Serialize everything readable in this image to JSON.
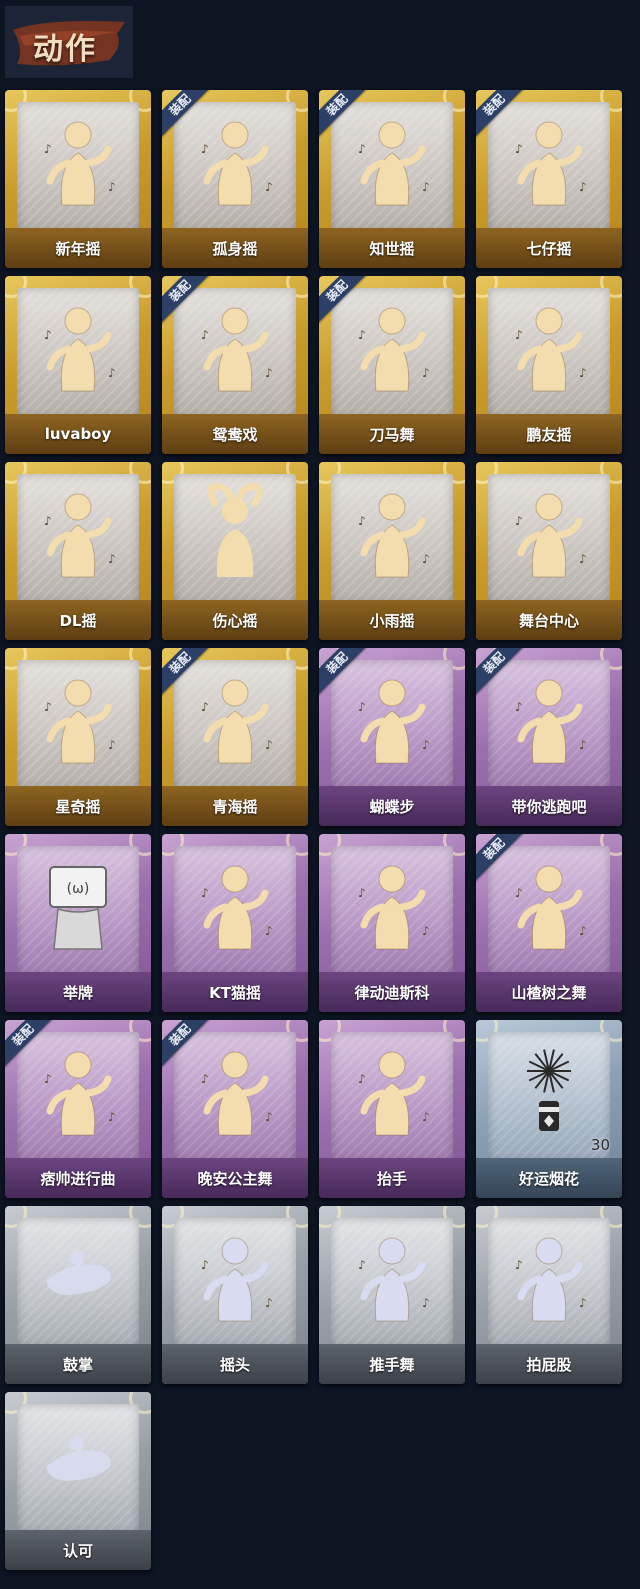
{
  "header": {
    "title": "动作"
  },
  "badge_text": "装配",
  "colors": {
    "gold": "#c99b2b",
    "purple": "#9b6fae",
    "blue": "#8da1b6",
    "grey": "#9aa0a8",
    "figure_gold": "#f3dcae",
    "figure_grey": "#d9dcf0"
  },
  "actions": [
    {
      "label": "新年摇",
      "rarity": "gold",
      "equipped": false,
      "icon": "dance-figure-icon"
    },
    {
      "label": "孤身摇",
      "rarity": "gold",
      "equipped": true,
      "icon": "dance-figure-icon"
    },
    {
      "label": "知世摇",
      "rarity": "gold",
      "equipped": true,
      "icon": "dance-figure-icon"
    },
    {
      "label": "七仔摇",
      "rarity": "gold",
      "equipped": true,
      "icon": "dance-figure-icon"
    },
    {
      "label": "luvaboy",
      "rarity": "gold",
      "equipped": false,
      "icon": "dance-figure-icon"
    },
    {
      "label": "鸳鸯戏",
      "rarity": "gold",
      "equipped": true,
      "icon": "dance-figure-icon"
    },
    {
      "label": "刀马舞",
      "rarity": "gold",
      "equipped": true,
      "icon": "dance-figure-icon"
    },
    {
      "label": "鹏友摇",
      "rarity": "gold",
      "equipped": false,
      "icon": "dance-figure-icon"
    },
    {
      "label": "DL摇",
      "rarity": "gold",
      "equipped": false,
      "icon": "dance-figure-icon"
    },
    {
      "label": "伤心摇",
      "rarity": "gold",
      "equipped": false,
      "icon": "heart-hands-figure-icon"
    },
    {
      "label": "小雨摇",
      "rarity": "gold",
      "equipped": false,
      "icon": "dance-figure-icon"
    },
    {
      "label": "舞台中心",
      "rarity": "gold",
      "equipped": false,
      "icon": "dance-figure-icon"
    },
    {
      "label": "星奇摇",
      "rarity": "gold",
      "equipped": false,
      "icon": "dance-figure-icon"
    },
    {
      "label": "青海摇",
      "rarity": "gold",
      "equipped": true,
      "icon": "dance-figure-icon"
    },
    {
      "label": "蝴蝶步",
      "rarity": "purple",
      "equipped": true,
      "icon": "dance-figure-icon"
    },
    {
      "label": "带你逃跑吧",
      "rarity": "purple",
      "equipped": true,
      "icon": "dance-figure-icon"
    },
    {
      "label": "举牌",
      "rarity": "purple",
      "equipped": false,
      "icon": "sign-holding-figure-icon"
    },
    {
      "label": "KT猫摇",
      "rarity": "purple",
      "equipped": false,
      "icon": "dance-figure-icon"
    },
    {
      "label": "律动迪斯科",
      "rarity": "purple",
      "equipped": false,
      "icon": "dance-figure-icon"
    },
    {
      "label": "山楂树之舞",
      "rarity": "purple",
      "equipped": true,
      "icon": "dance-figure-icon"
    },
    {
      "label": "痞帅进行曲",
      "rarity": "purple",
      "equipped": true,
      "icon": "dance-figure-icon"
    },
    {
      "label": "晚安公主舞",
      "rarity": "purple",
      "equipped": true,
      "icon": "dance-figure-icon"
    },
    {
      "label": "抬手",
      "rarity": "purple",
      "equipped": false,
      "icon": "raise-hand-figure-icon"
    },
    {
      "label": "好运烟花",
      "rarity": "blue",
      "equipped": false,
      "icon": "firework-icon",
      "count": "30"
    },
    {
      "label": "鼓掌",
      "rarity": "grey",
      "equipped": false,
      "icon": "clapping-hands-icon"
    },
    {
      "label": "摇头",
      "rarity": "grey",
      "equipped": false,
      "icon": "dance-figure-icon"
    },
    {
      "label": "推手舞",
      "rarity": "grey",
      "equipped": false,
      "icon": "dance-figure-icon"
    },
    {
      "label": "拍屁股",
      "rarity": "grey",
      "equipped": false,
      "icon": "dance-figure-icon"
    },
    {
      "label": "认可",
      "rarity": "grey",
      "equipped": false,
      "icon": "thumbs-up-icon"
    }
  ]
}
